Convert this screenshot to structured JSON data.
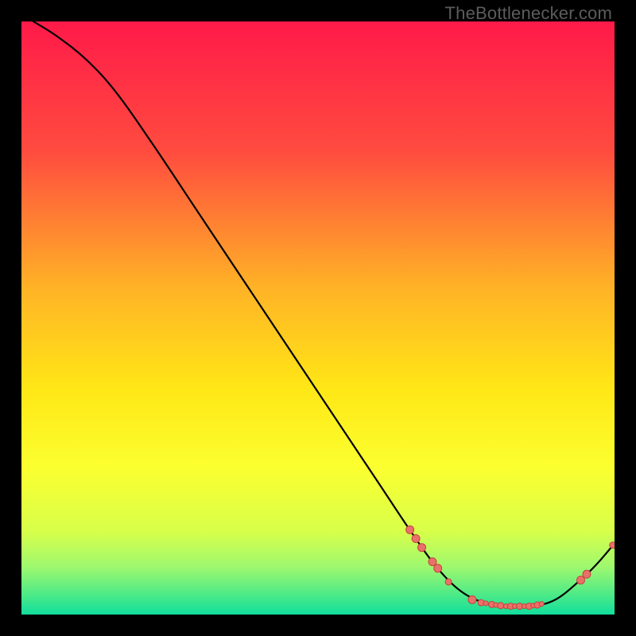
{
  "watermark": "TheBottlenecker.com",
  "colors": {
    "background": "#000000",
    "watermark": "#5c5c5c",
    "curve": "#000000",
    "marker_fill": "#e9716a",
    "marker_stroke": "#c7433c"
  },
  "chart_data": {
    "type": "line",
    "title": "",
    "xlabel": "",
    "ylabel": "",
    "xlim": [
      0,
      100
    ],
    "ylim": [
      0,
      100
    ],
    "gradient_stops": [
      {
        "offset": 0.0,
        "color": "#ff1a49"
      },
      {
        "offset": 0.22,
        "color": "#ff4c3f"
      },
      {
        "offset": 0.45,
        "color": "#ffb326"
      },
      {
        "offset": 0.62,
        "color": "#ffe716"
      },
      {
        "offset": 0.75,
        "color": "#fcff2f"
      },
      {
        "offset": 0.86,
        "color": "#d8ff4a"
      },
      {
        "offset": 0.92,
        "color": "#9ef86f"
      },
      {
        "offset": 0.97,
        "color": "#46e989"
      },
      {
        "offset": 1.0,
        "color": "#11de9d"
      }
    ],
    "curve": [
      {
        "x": 2.0,
        "y": 100.0
      },
      {
        "x": 6.0,
        "y": 97.5
      },
      {
        "x": 11.0,
        "y": 93.5
      },
      {
        "x": 16.0,
        "y": 88.0
      },
      {
        "x": 22.0,
        "y": 79.5
      },
      {
        "x": 30.0,
        "y": 67.5
      },
      {
        "x": 38.0,
        "y": 55.5
      },
      {
        "x": 46.0,
        "y": 43.5
      },
      {
        "x": 54.0,
        "y": 31.5
      },
      {
        "x": 60.0,
        "y": 22.5
      },
      {
        "x": 66.0,
        "y": 13.5
      },
      {
        "x": 70.0,
        "y": 8.0
      },
      {
        "x": 74.0,
        "y": 4.0
      },
      {
        "x": 78.0,
        "y": 2.0
      },
      {
        "x": 82.0,
        "y": 1.4
      },
      {
        "x": 86.0,
        "y": 1.4
      },
      {
        "x": 90.0,
        "y": 2.5
      },
      {
        "x": 94.0,
        "y": 5.6
      },
      {
        "x": 97.0,
        "y": 8.5
      },
      {
        "x": 100.0,
        "y": 12.0
      }
    ],
    "markers": [
      {
        "x": 65.5,
        "y": 14.3,
        "r": 5
      },
      {
        "x": 66.5,
        "y": 12.8,
        "r": 5
      },
      {
        "x": 67.5,
        "y": 11.3,
        "r": 5
      },
      {
        "x": 69.3,
        "y": 8.9,
        "r": 5
      },
      {
        "x": 70.2,
        "y": 7.8,
        "r": 5
      },
      {
        "x": 72.0,
        "y": 5.5,
        "r": 4
      },
      {
        "x": 76.0,
        "y": 2.5,
        "r": 5
      },
      {
        "x": 77.5,
        "y": 2.0,
        "r": 4
      },
      {
        "x": 78.3,
        "y": 1.9,
        "r": 3
      },
      {
        "x": 79.3,
        "y": 1.7,
        "r": 4
      },
      {
        "x": 80.0,
        "y": 1.6,
        "r": 3
      },
      {
        "x": 80.8,
        "y": 1.5,
        "r": 4
      },
      {
        "x": 81.7,
        "y": 1.4,
        "r": 3
      },
      {
        "x": 82.5,
        "y": 1.4,
        "r": 4
      },
      {
        "x": 83.2,
        "y": 1.4,
        "r": 3
      },
      {
        "x": 84.0,
        "y": 1.4,
        "r": 4
      },
      {
        "x": 84.8,
        "y": 1.4,
        "r": 3
      },
      {
        "x": 85.6,
        "y": 1.4,
        "r": 4
      },
      {
        "x": 86.3,
        "y": 1.5,
        "r": 3
      },
      {
        "x": 87.0,
        "y": 1.6,
        "r": 4
      },
      {
        "x": 87.7,
        "y": 1.8,
        "r": 3
      },
      {
        "x": 94.3,
        "y": 5.8,
        "r": 5
      },
      {
        "x": 95.3,
        "y": 6.8,
        "r": 5
      },
      {
        "x": 99.7,
        "y": 11.7,
        "r": 4
      }
    ]
  }
}
